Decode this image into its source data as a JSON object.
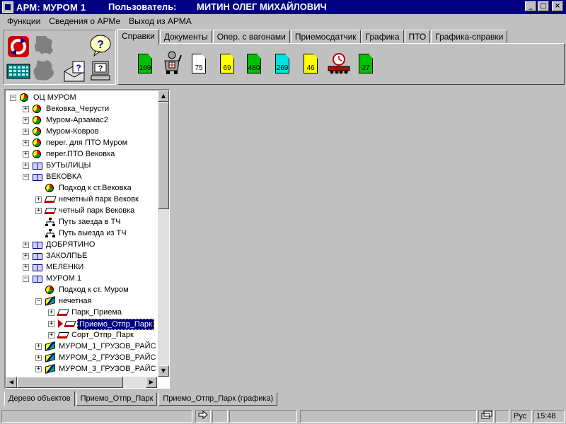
{
  "window": {
    "title": "АРМ: МУРОМ 1",
    "user_label": "Пользователь:",
    "user_name": "МИТИН ОЛЕГ МИХАЙЛОВИЧ",
    "controls": {
      "minimize": "_",
      "maximize": "□",
      "close": "×"
    }
  },
  "menu": [
    {
      "label": "Функции"
    },
    {
      "label": "Сведения о АРМе"
    },
    {
      "label": "Выход из АРМА"
    }
  ],
  "tool_icons": [
    {
      "name": "refresh-icon",
      "color": "#d00000"
    },
    {
      "name": "puzzle-icon-top",
      "color": "#808080"
    },
    {
      "name": "help-icon",
      "color": "#0000c0"
    },
    {
      "name": "calculator-icon",
      "color": "#008080"
    },
    {
      "name": "puzzle-icon-bottom",
      "color": "#808080"
    },
    {
      "name": "mail-icon",
      "color": "#808080"
    },
    {
      "name": "computer-help-icon",
      "color": "#808080"
    }
  ],
  "tabs": [
    {
      "label": "Справки",
      "active": true
    },
    {
      "label": "Документы"
    },
    {
      "label": "Опер. с вагонами"
    },
    {
      "label": "Приемосдатчик"
    },
    {
      "label": "Графика"
    },
    {
      "label": "ПТО"
    },
    {
      "label": "Графика-справки"
    }
  ],
  "doc_icons": [
    {
      "num": "169",
      "color": "#00c000"
    },
    {
      "num": "",
      "color": "#a0a0a0",
      "name": "worker-icon"
    },
    {
      "num": "75",
      "color": "#ffffff"
    },
    {
      "num": "69",
      "color": "#ffff00"
    },
    {
      "num": "480",
      "color": "#00c000"
    },
    {
      "num": "269",
      "color": "#00e0e0"
    },
    {
      "num": "46",
      "color": "#ffff00"
    },
    {
      "num": "",
      "color": "#c00000",
      "name": "railcar-clock-icon"
    },
    {
      "num": "27",
      "color": "#00c000"
    }
  ],
  "tree": [
    {
      "label": "ОЦ МУРОМ",
      "level": 0,
      "exp": "−",
      "icon": "pie"
    },
    {
      "label": "Вековка_Черусти",
      "level": 1,
      "exp": "+",
      "icon": "pie"
    },
    {
      "label": "Муром-Арзамас2",
      "level": 1,
      "exp": "+",
      "icon": "pie"
    },
    {
      "label": "Муром-Ковров",
      "level": 1,
      "exp": "+",
      "icon": "pie"
    },
    {
      "label": "перег. для ПТО Муром",
      "level": 1,
      "exp": "+",
      "icon": "pie"
    },
    {
      "label": "перег.ПТО Вековка",
      "level": 1,
      "exp": "+",
      "icon": "pie"
    },
    {
      "label": "БУТЫЛИЦЫ",
      "level": 1,
      "exp": "+",
      "icon": "book"
    },
    {
      "label": "ВЕКОВКА",
      "level": 1,
      "exp": "−",
      "icon": "book"
    },
    {
      "label": "Подход к ст.Вековка",
      "level": 2,
      "exp": "",
      "icon": "pie"
    },
    {
      "label": "нечетный парк Вековк",
      "level": 2,
      "exp": "+",
      "icon": "wag"
    },
    {
      "label": "четный парк Вековка",
      "level": 2,
      "exp": "+",
      "icon": "wag"
    },
    {
      "label": "Путь заезда в ТЧ",
      "level": 2,
      "exp": "",
      "icon": "net"
    },
    {
      "label": "Путь выезда из ТЧ",
      "level": 2,
      "exp": "",
      "icon": "net"
    },
    {
      "label": "ДОБРЯТИНО",
      "level": 1,
      "exp": "+",
      "icon": "book"
    },
    {
      "label": "ЗАКОЛПЬЕ",
      "level": 1,
      "exp": "+",
      "icon": "book"
    },
    {
      "label": "МЕЛЕНКИ",
      "level": 1,
      "exp": "+",
      "icon": "book"
    },
    {
      "label": "МУРОМ 1",
      "level": 1,
      "exp": "−",
      "icon": "book"
    },
    {
      "label": "Подход к ст. Муром",
      "level": 2,
      "exp": "",
      "icon": "pie"
    },
    {
      "label": "нечетная",
      "level": 2,
      "exp": "−",
      "icon": "flag"
    },
    {
      "label": "Парк_Приема",
      "level": 3,
      "exp": "+",
      "icon": "wag"
    },
    {
      "label": "Приемо_Отпр_Парк",
      "level": 3,
      "exp": "+",
      "icon": "wag",
      "selected": true,
      "pointer": true
    },
    {
      "label": "Сорт_Отпр_Парк",
      "level": 3,
      "exp": "+",
      "icon": "wag"
    },
    {
      "label": "МУРОМ_1_ГРУЗОВ_РАЙС",
      "level": 2,
      "exp": "+",
      "icon": "flag"
    },
    {
      "label": "МУРОМ_2_ГРУЗОВ_РАЙС",
      "level": 2,
      "exp": "+",
      "icon": "flag"
    },
    {
      "label": "МУРОМ_3_ГРУЗОВ_РАЙС",
      "level": 2,
      "exp": "+",
      "icon": "flag"
    }
  ],
  "bottom_tabs": [
    {
      "label": "Дерево объектов",
      "active": true
    },
    {
      "label": "Приемо_Отпр_Парк"
    },
    {
      "label": "Приемо_Отпр_Парк (графика)"
    }
  ],
  "status": {
    "lang": "Рус",
    "time": "15:48"
  }
}
